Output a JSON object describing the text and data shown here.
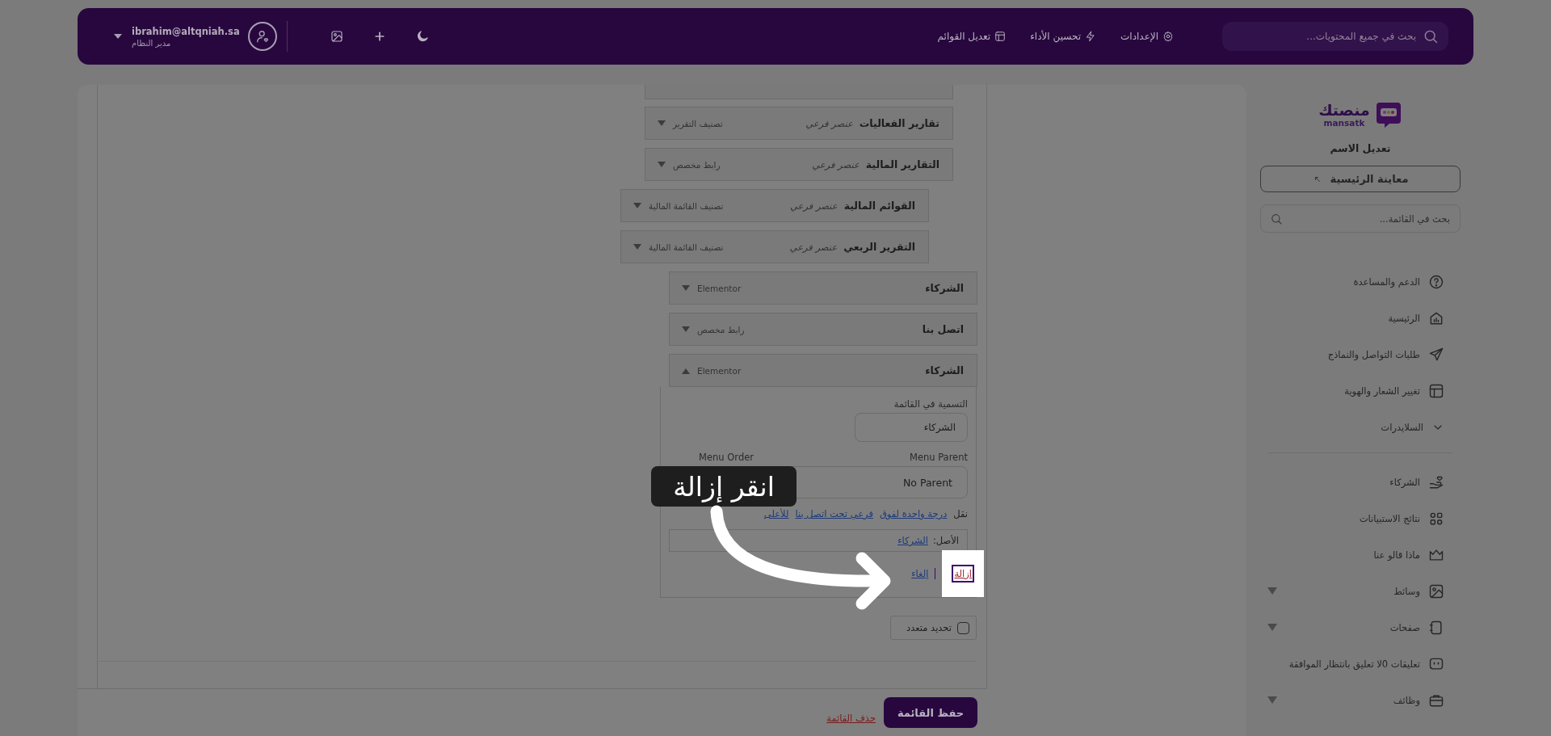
{
  "topbar": {
    "search": {
      "placeholder": "بحث في جميع المحتويات..."
    },
    "nav": [
      {
        "label": "الإعدادات"
      },
      {
        "label": "تحسين الأداء"
      },
      {
        "label": "تعديل القوائم"
      }
    ],
    "user": {
      "email": "ibrahim@altqniah.sa",
      "role": "مدير النظام"
    }
  },
  "sidebar": {
    "logo": {
      "name": "منصتك",
      "latin": "mansatk"
    },
    "site_title": "تعديل الاسم",
    "preview_button": "معاينة الرئيسية",
    "search": {
      "placeholder": "بحث في القائمة..."
    },
    "sections": [
      {
        "items": [
          {
            "kind": "link",
            "label": "الدعم والمساعدة",
            "has_submenu": false
          },
          {
            "kind": "link",
            "label": "الرئيسية",
            "has_submenu": false
          },
          {
            "kind": "link",
            "label": "طلبات التواصل والنماذج",
            "has_submenu": false
          },
          {
            "kind": "link",
            "label": "تغيير الشعار والهوية",
            "has_submenu": false
          },
          {
            "kind": "group",
            "label": "السلايدرات",
            "has_submenu": false
          }
        ]
      },
      {
        "items": [
          {
            "kind": "link",
            "label": "الشركاء",
            "has_submenu": false
          },
          {
            "kind": "link",
            "label": "نتائج الاستبيانات",
            "has_submenu": false
          },
          {
            "kind": "link",
            "label": "ماذا قالو عنا",
            "has_submenu": false
          },
          {
            "kind": "link",
            "label": "وسائط",
            "has_submenu": true
          },
          {
            "kind": "link",
            "label": "صفحات",
            "has_submenu": true
          },
          {
            "kind": "link",
            "label": "تعليقات 0لا تعليق بانتظار الموافقة",
            "has_submenu": false
          },
          {
            "kind": "link",
            "label": "وظائف",
            "has_submenu": true
          }
        ]
      }
    ]
  },
  "menu_editor": {
    "items": [
      {
        "kind": "offscreen",
        "children": [
          {
            "kind": "clipped"
          },
          {
            "kind": "item",
            "title": "تقارير الفعاليات",
            "subtitle": "عنصر فرعي",
            "type": "تصنيف التقرير",
            "expanded": false
          },
          {
            "kind": "item",
            "title": "التقارير المالية",
            "subtitle": "عنصر فرعي",
            "type": "رابط مخصص",
            "expanded": false,
            "children": [
              {
                "kind": "item",
                "title": "القوائم المالية",
                "subtitle": "عنصر فرعي",
                "type": "تصنيف القائمة المالية",
                "expanded": false
              },
              {
                "kind": "item",
                "title": "التقرير الربعي",
                "subtitle": "عنصر فرعي",
                "type": "تصنيف القائمة المالية",
                "expanded": false
              }
            ]
          }
        ]
      },
      {
        "kind": "item",
        "title": "الشركاء",
        "type": "Elementor",
        "expanded": false
      },
      {
        "kind": "item",
        "title": "اتصل بنا",
        "type": "رابط مخصص",
        "expanded": false
      },
      {
        "kind": "item",
        "title": "الشركاء",
        "type": "Elementor",
        "expanded": true,
        "settings": {
          "label_caption": "التسمية في القائمة",
          "label_value": "الشركاء",
          "parent_caption": "Menu Parent",
          "parent_value": "No Parent",
          "order_caption": "Menu Order",
          "move_caption": "نقل",
          "move_links": [
            "درجة واحدة لفوق",
            "فرعي تحت اتصل بنا",
            "للأعلى"
          ],
          "original_caption": "الأصل:",
          "original_link": "الشركاء",
          "remove_link": "إزالة",
          "remove_highlighted": true,
          "cancel_link": "إلغاء"
        }
      }
    ],
    "multi_select": {
      "label": "تحديد متعدد",
      "checked": false
    },
    "save_button": "حفظ القائمة",
    "delete_link": "حذف القائمة"
  },
  "tutorial": {
    "callout": "انقر إزالة"
  }
}
